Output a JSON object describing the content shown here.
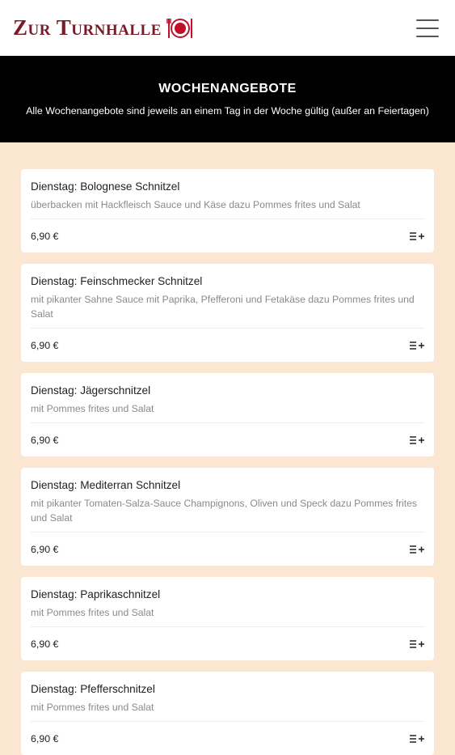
{
  "header": {
    "logo_text": "Zur Turnhalle",
    "menu_icon": "hamburger-menu-icon"
  },
  "hero": {
    "title": "WOCHENANGEBOTE",
    "subtitle": "Alle Wochenangebote sind jeweils an einem Tag in der Woche gültig (außer an Feiertagen)"
  },
  "colors": {
    "brand": "#7a1a28",
    "page_background": "#fbe6d2",
    "hero_background": "#000000"
  },
  "offers": [
    {
      "title": "Dienstag: Bolognese Schnitzel",
      "description": "überbacken mit Hackfleisch Sauce und Käse dazu Pommes frites und Salat",
      "price": "6,90 €",
      "icon": "add-to-list-icon"
    },
    {
      "title": "Dienstag: Feinschmecker Schnitzel",
      "description": "mit pikanter Sahne Sauce mit Paprika, Pfefferoni und Fetakäse dazu Pommes frites und Salat",
      "price": "6,90 €",
      "icon": "add-to-list-icon"
    },
    {
      "title": "Dienstag: Jägerschnitzel",
      "description": "mit Pommes frites und Salat",
      "price": "6,90 €",
      "icon": "add-to-list-icon"
    },
    {
      "title": "Dienstag: Mediterran Schnitzel",
      "description": "mit pikanter Tomaten-Salza-Sauce Champignons, Oliven und Speck dazu Pommes frites und Salat",
      "price": "6,90 €",
      "icon": "add-to-list-icon"
    },
    {
      "title": "Dienstag: Paprikaschnitzel",
      "description": "mit Pommes frites und Salat",
      "price": "6,90 €",
      "icon": "add-to-list-icon"
    },
    {
      "title": "Dienstag: Pfefferschnitzel",
      "description": "mit Pommes frites und Salat",
      "price": "6,90 €",
      "icon": "add-to-list-icon"
    }
  ]
}
